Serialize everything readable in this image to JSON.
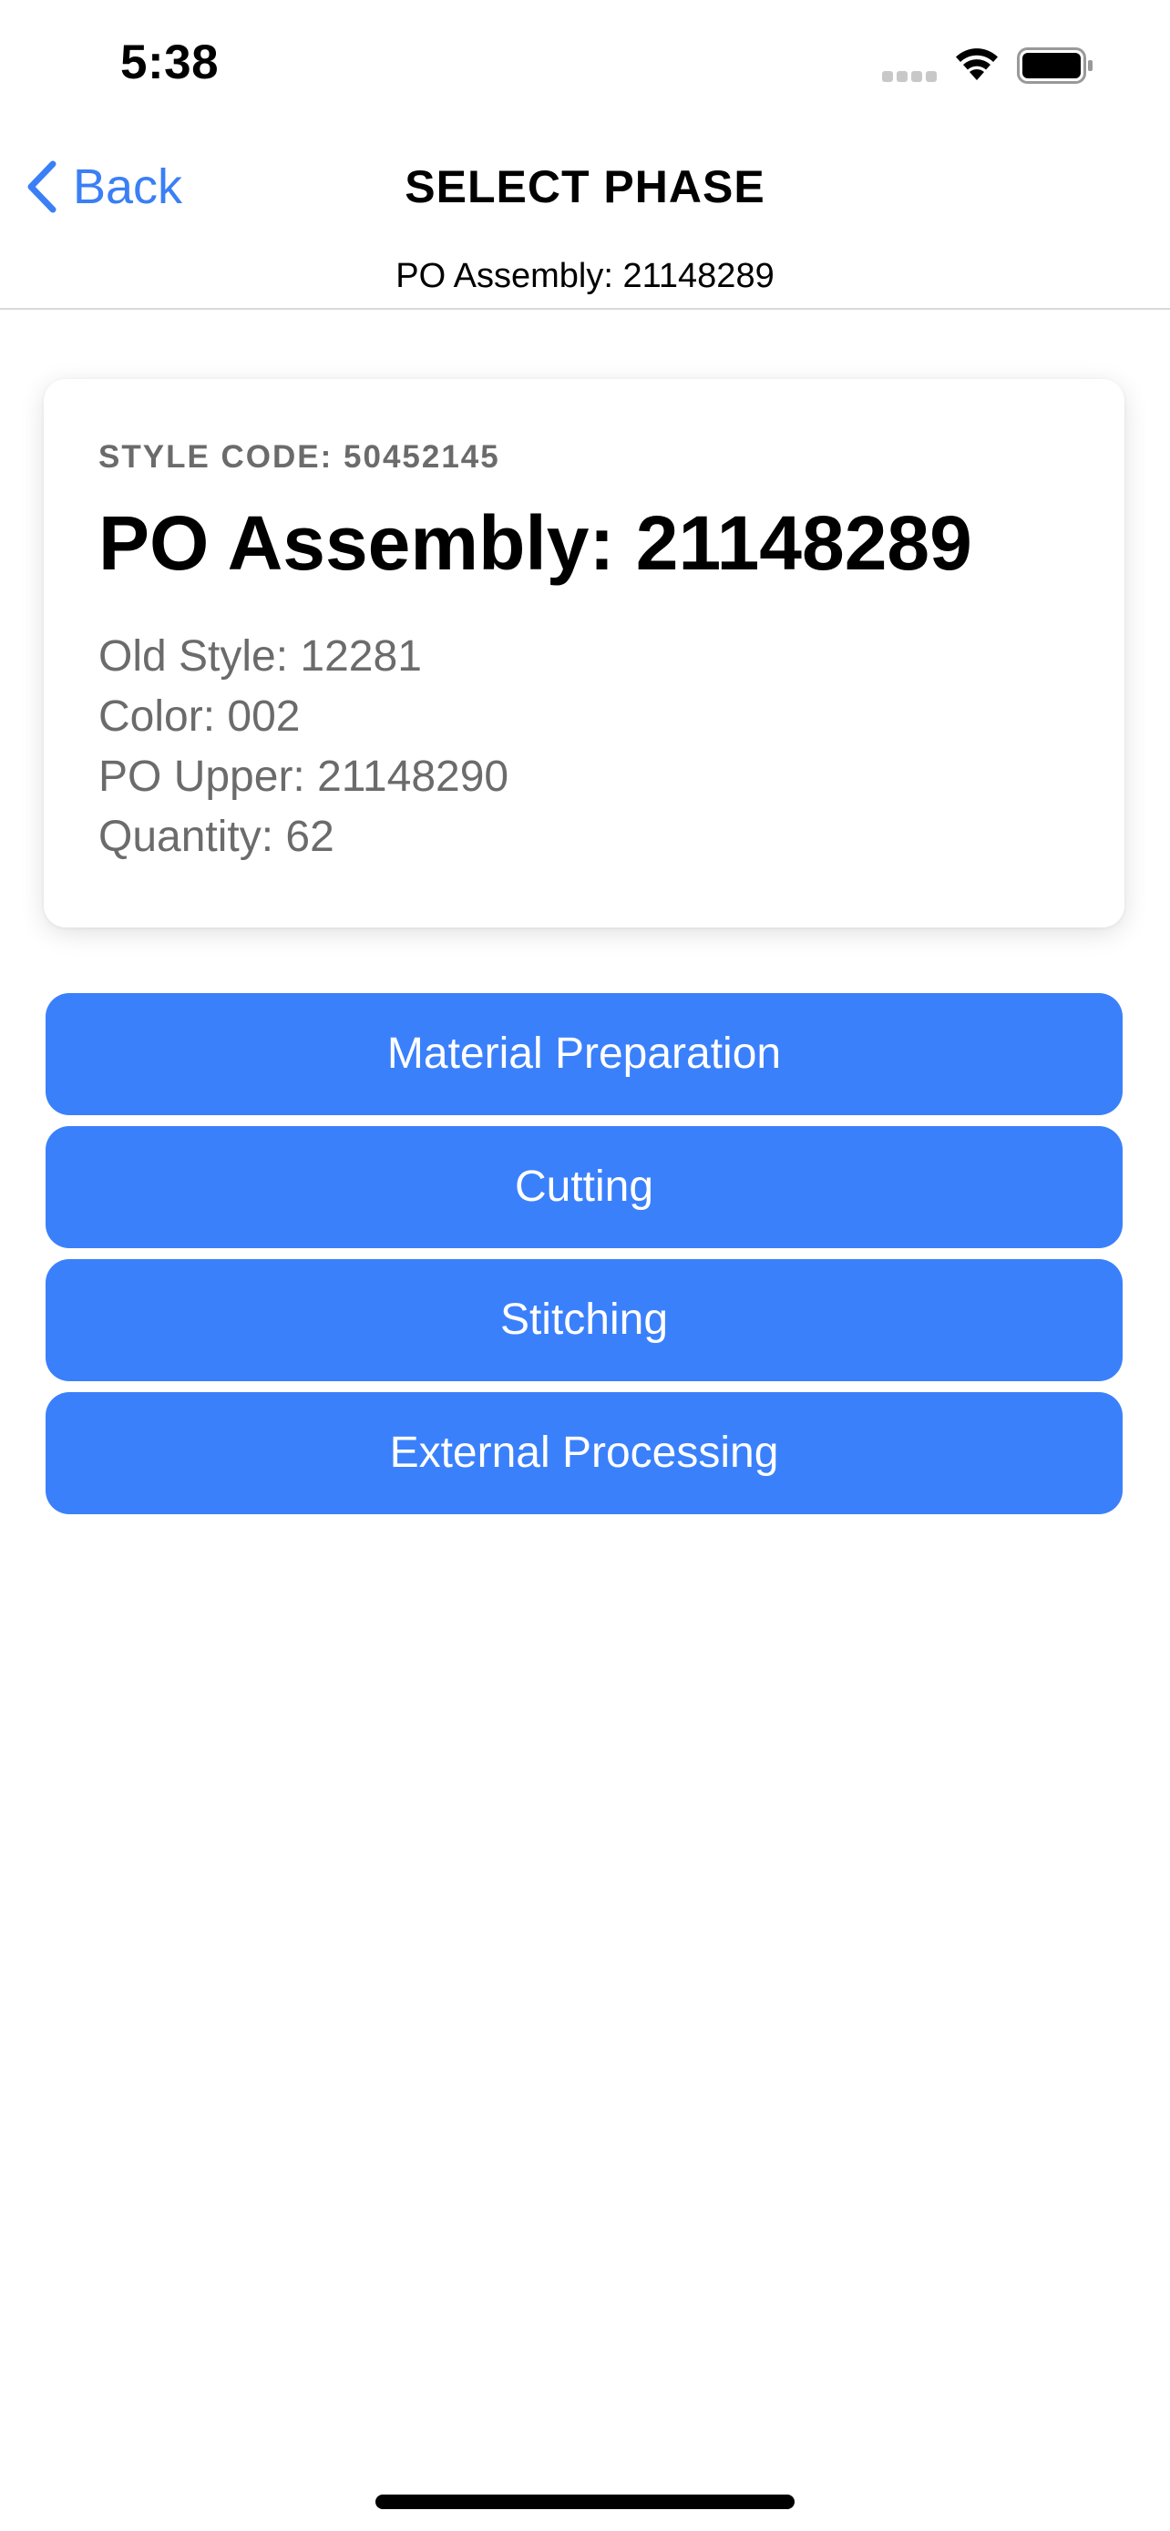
{
  "status_bar": {
    "time": "5:38",
    "icons": [
      "cellular-signal-icon",
      "wifi-icon",
      "battery-icon"
    ]
  },
  "nav": {
    "back_label": "Back",
    "title": "SELECT PHASE",
    "subtitle": "PO Assembly: 21148289"
  },
  "card": {
    "style_code": "STYLE CODE: 50452145",
    "title": "PO Assembly: 21148289",
    "details": [
      "Old Style: 12281",
      "Color: 002",
      "PO Upper: 21148290",
      "Quantity: 62"
    ]
  },
  "phases": [
    "Material Preparation",
    "Cutting",
    "Stitching",
    "External Processing"
  ],
  "colors": {
    "accent": "#3b80fb",
    "back_link": "#3a7ff5",
    "muted_text": "#6b6b6b"
  }
}
